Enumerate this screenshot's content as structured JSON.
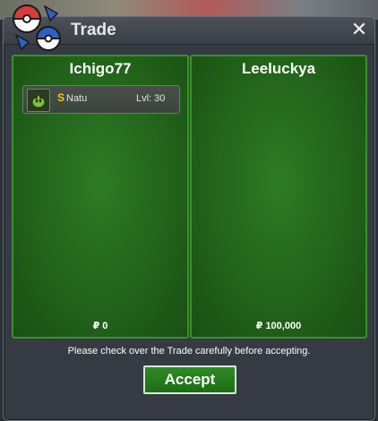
{
  "window": {
    "title": "Trade",
    "close_label": "✕"
  },
  "left_panel": {
    "player": "Ichigo77",
    "items": [
      {
        "shiny_badge": "S",
        "name": "Natu",
        "level": "Lvl: 30"
      }
    ],
    "money_symbol": "₽",
    "money": "0"
  },
  "right_panel": {
    "player": "Leeluckya",
    "money_symbol": "₽",
    "money": "100,000"
  },
  "notice": "Please check over the Trade carefully before accepting.",
  "accept_label": "Accept",
  "colors": {
    "panel_green": "#2f7a25",
    "panel_border": "#3c8f2f",
    "window_bg": "#353a43",
    "shiny_gold": "#f5c51f"
  }
}
